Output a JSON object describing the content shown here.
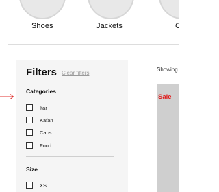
{
  "categories": {
    "items": [
      {
        "label": "Shoes"
      },
      {
        "label": "Jackets"
      },
      {
        "label": "C"
      }
    ]
  },
  "filters": {
    "title": "Filters",
    "clear_label": "Clear filters",
    "categories_section": {
      "title": "Categories",
      "options": [
        {
          "label": "Itar",
          "checked": false
        },
        {
          "label": "Kafan",
          "checked": false
        },
        {
          "label": "Caps",
          "checked": false
        },
        {
          "label": "Food",
          "checked": false
        }
      ]
    },
    "size_section": {
      "title": "Size",
      "options": [
        {
          "label": "XS",
          "checked": false
        }
      ]
    }
  },
  "results": {
    "showing_text": "Showing",
    "sale_badge": "Sale"
  },
  "colors": {
    "arrow": "#e0322f",
    "sale": "#e01e1e",
    "panel_bg": "#f5f5f5",
    "card_bg": "#cfcfcf"
  }
}
